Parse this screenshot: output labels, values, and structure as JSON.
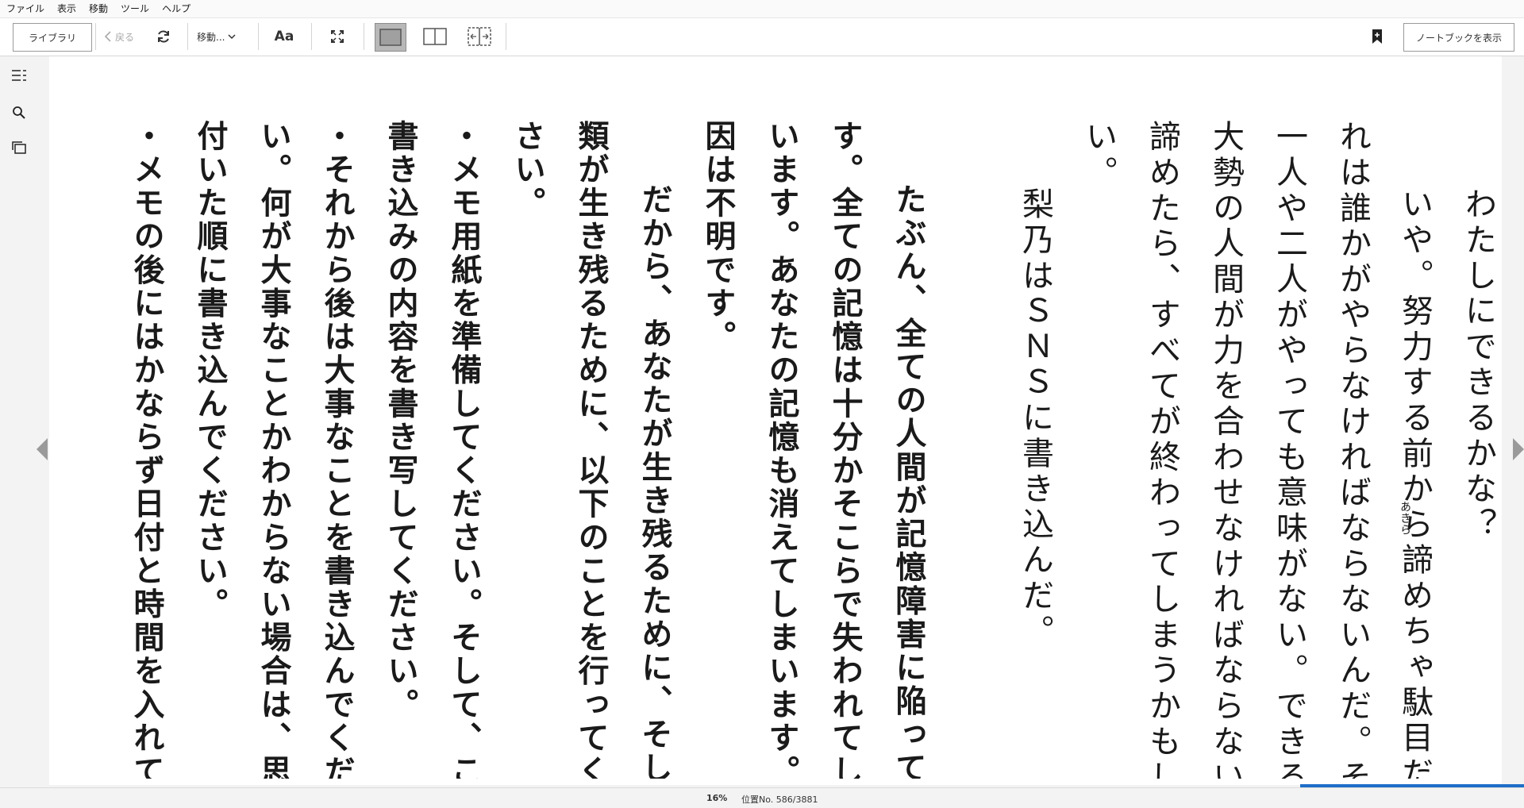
{
  "menu": [
    "ファイル",
    "表示",
    "移動",
    "ツール",
    "ヘルプ"
  ],
  "toolbar": {
    "library_label": "ライブラリ",
    "back_label": "戻る",
    "goto_label": "移動...",
    "font_label": "Aa",
    "notebook_label": "ノートブックを表示"
  },
  "icons": {
    "toc": "toc-icon",
    "search": "search-icon",
    "flashcards": "flashcards-icon",
    "refresh": "refresh-icon",
    "fullscreen": "fullscreen-icon",
    "bookmark": "bookmark-icon",
    "single_page": "single-column-icon",
    "double_page": "two-column-icon",
    "scroll": "scroll-view-icon"
  },
  "page": {
    "columns": [
      "わたしにできるかな？",
      "いや。努力する前から諦めちゃ駄目だ。こ",
      "れは誰かがやらなければならないんだ。それも、",
      "一人や二人がやっても意味がない。できるだけ",
      "大勢の人間が力を合わせなければならない。今、",
      "諦めたら、すべてが終わってしまうかもしれな",
      "い。",
      "梨乃はＳＮＳに書き込んだ。",
      "たぶん、全ての人間が記憶障害に陥っていま",
      "す。全ての記憶は十分かそこらで失われてしま",
      "います。あなたの記憶も消えてしまいます。原",
      "因は不明です。",
      "だから、あなたが生き残るために、そして人",
      "類が生き残るために、以下のことを行ってくだ",
      "さい。",
      "・メモ用紙を準備してください。そして、この",
      "書き込みの内容を書き写してください。",
      "・それから後は大事なことを書き込んでくださ",
      "い。何が大事なことかわからない場合は、思い",
      "付いた順に書き込んでください。",
      "・メモの後にはかならず日付と時間を入れてく"
    ],
    "ruby": "あきら"
  },
  "status": {
    "percent": "16%",
    "location": "位置No. 586/3881",
    "progress": 0.16
  },
  "colors": {
    "accent": "#1e6ec8",
    "page_bg": "#ffffff",
    "chrome_bg": "#f3f3f3"
  }
}
